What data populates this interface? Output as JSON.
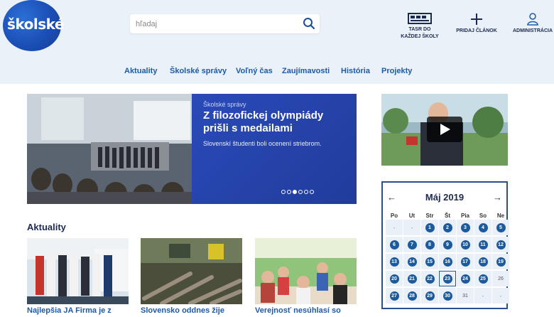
{
  "brand": {
    "logo_text": "školské",
    "color": "#1b4fb5"
  },
  "search": {
    "placeholder": "hľadaj",
    "icon": "search-icon"
  },
  "header_actions": [
    {
      "label1": "TASR DO",
      "label2": "KAŽDEJ ŠKOLY",
      "icon": "tasr-icon"
    },
    {
      "label1": "PRIDAJ ČLÁNOK",
      "icon": "plus-icon"
    },
    {
      "label1": "ADMINISTRÁCIA",
      "icon": "user-icon"
    }
  ],
  "nav": [
    "Aktuality",
    "Školské správy",
    "Voľný čas",
    "Zaujímavosti",
    "História",
    "Projekty"
  ],
  "hero": {
    "category": "Školské správy",
    "title": "Z filozofickej olympiády prišli s medailami",
    "lead": "Slovenskí študenti boli ocenení striebrom.",
    "slides": 6,
    "active_slide": 3
  },
  "calendar": {
    "title": "Máj 2019",
    "prev": "←",
    "next": "→",
    "day_names": [
      "Po",
      "Ut",
      "Str",
      "Št",
      "Pia",
      "So",
      "Ne"
    ],
    "weeks": [
      [
        "-",
        "-",
        "1",
        "2",
        "3",
        "4",
        "5"
      ],
      [
        "6",
        "7",
        "8",
        "9",
        "10",
        "11",
        "12"
      ],
      [
        "13",
        "14",
        "15",
        "16",
        "17",
        "18",
        "19"
      ],
      [
        "20",
        "21",
        "22",
        "23",
        "24",
        "25",
        "26"
      ],
      [
        "27",
        "28",
        "29",
        "30",
        "31",
        "-",
        "-"
      ]
    ],
    "plain_days": [
      "26",
      "31"
    ],
    "selected_day": "23"
  },
  "news": {
    "section_title": "Aktuality",
    "cards": [
      {
        "title": "Najlepšia JA Firma je z"
      },
      {
        "title": "Slovensko oddnes žije"
      },
      {
        "title": "Verejnosť nesúhlasí so"
      }
    ]
  }
}
